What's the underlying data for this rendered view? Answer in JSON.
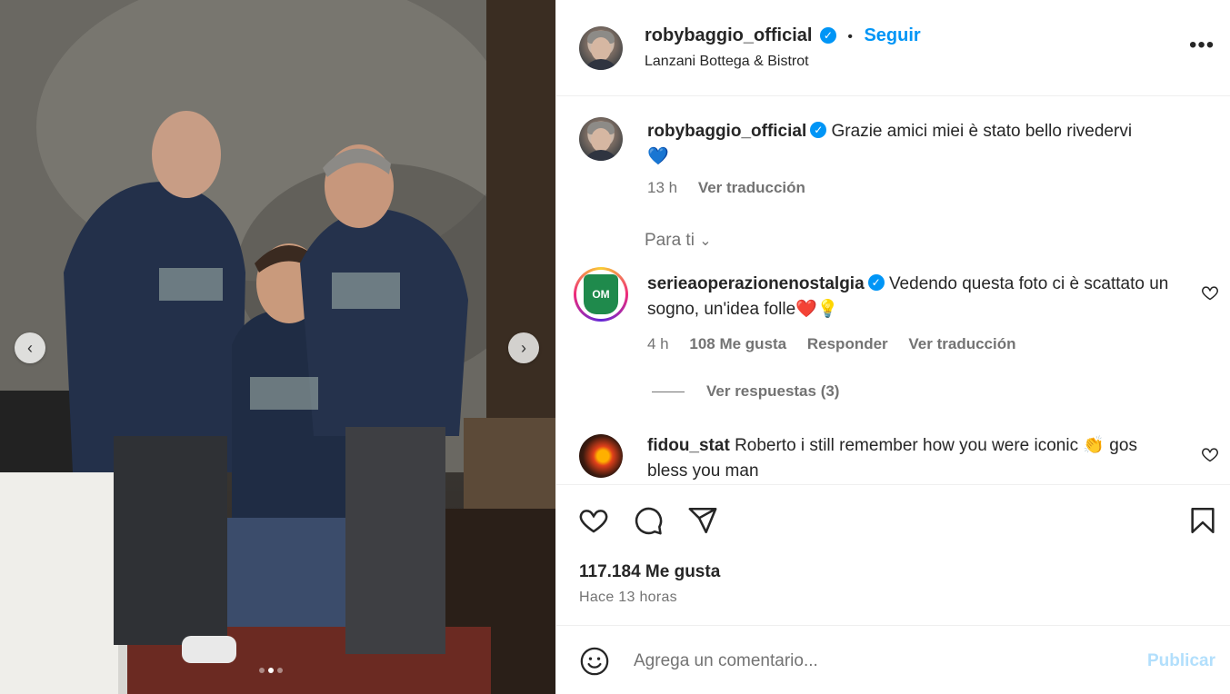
{
  "post": {
    "username": "robybaggio_official",
    "verified": true,
    "follow_label": "Seguir",
    "separator": "•",
    "location": "Lanzani Bottega & Bistrot",
    "more_icon": "more-horizontal-icon",
    "carousel": {
      "slide_count": 3,
      "active_slide": 2
    }
  },
  "caption": {
    "username": "robybaggio_official",
    "text": "Grazie amici miei è stato bello rivedervi",
    "emoji": "💙",
    "time": "13 h",
    "translate": "Ver traducción"
  },
  "filter": {
    "label": "Para ti"
  },
  "comments": [
    {
      "username": "serieaoperazionenostalgia",
      "verified": true,
      "text": "Vedendo questa foto ci è scattato un sogno, un'idea folle❤️💡",
      "time": "4 h",
      "likes": "108 Me gusta",
      "reply": "Responder",
      "translate": "Ver traducción",
      "view_replies": "Ver respuestas (3)"
    },
    {
      "username": "fidou_stat",
      "verified": false,
      "text": "Roberto i still remember how you were iconic 👏 gos bless you man"
    }
  ],
  "stats": {
    "likes": "117.184 Me gusta",
    "time_ago": "Hace 13 horas"
  },
  "composer": {
    "placeholder": "Agrega un comentario...",
    "publish_label": "Publicar"
  },
  "colors": {
    "accent": "#0095f6",
    "publish_disabled": "#b2dffc",
    "muted": "#737373"
  }
}
